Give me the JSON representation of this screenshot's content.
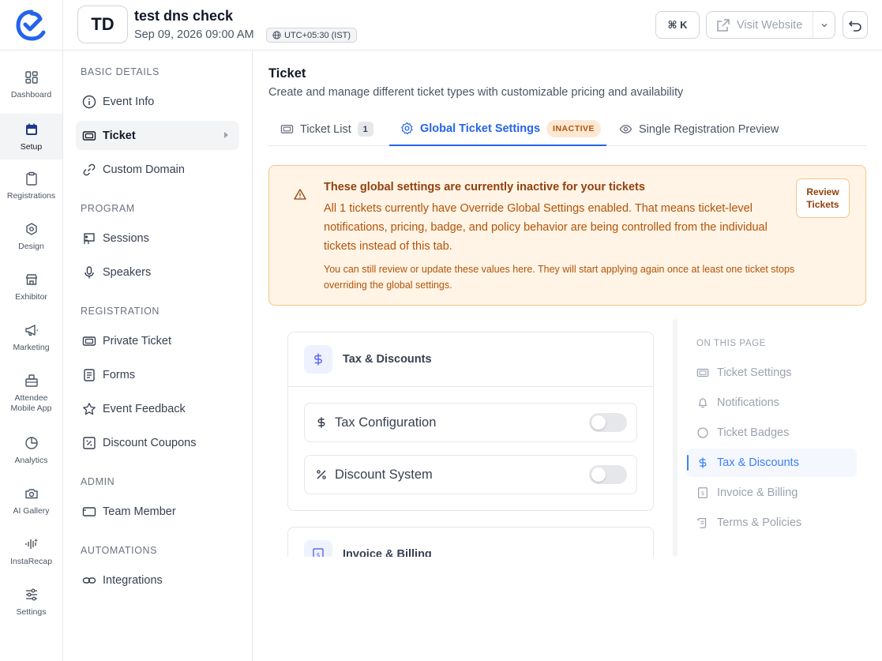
{
  "header": {
    "event_initials": "TD",
    "event_title": "test dns check",
    "event_date": "Sep 09, 2026 09:00 AM",
    "timezone": "UTC+05:30 (IST)",
    "shortcut_label": "⌘ K",
    "visit_label": "Visit Website"
  },
  "rail": {
    "items": [
      {
        "label": "Dashboard",
        "icon": "grid-icon"
      },
      {
        "label": "Setup",
        "icon": "calendar-icon"
      },
      {
        "label": "Registrations",
        "icon": "clipboard-icon"
      },
      {
        "label": "Design",
        "icon": "palette-icon"
      },
      {
        "label": "Exhibitor",
        "icon": "store-icon"
      },
      {
        "label": "Marketing",
        "icon": "megaphone-icon"
      },
      {
        "label": "Attendee",
        "label2": "Mobile App",
        "icon": "mobile-app-icon"
      },
      {
        "label": "Analytics",
        "icon": "pie-chart-icon"
      },
      {
        "label": "AI Gallery",
        "icon": "camera-icon"
      },
      {
        "label": "InstaRecap",
        "icon": "audio-wave-icon"
      },
      {
        "label": "Settings",
        "icon": "sliders-icon"
      }
    ],
    "active": "Setup"
  },
  "nav": {
    "sections": {
      "basic": "BASIC DETAILS",
      "program": "PROGRAM",
      "registration": "REGISTRATION",
      "admin": "ADMIN",
      "automations": "AUTOMATIONS"
    },
    "items": {
      "event_info": "Event Info",
      "ticket": "Ticket",
      "custom_domain": "Custom Domain",
      "sessions": "Sessions",
      "speakers": "Speakers",
      "private_ticket": "Private Ticket",
      "forms": "Forms",
      "event_feedback": "Event Feedback",
      "discount_coupons": "Discount Coupons",
      "team_member": "Team Member",
      "integrations": "Integrations"
    }
  },
  "main": {
    "title": "Ticket",
    "subtitle": "Create and manage different ticket types with customizable pricing and availability",
    "tabs": {
      "ticket_list": "Ticket List",
      "ticket_list_count": "1",
      "global_settings": "Global Ticket Settings",
      "global_badge": "INACTIVE",
      "preview": "Single Registration Preview"
    },
    "alert": {
      "title": "These global settings are currently inactive for your tickets",
      "body": "All 1 tickets currently have Override Global Settings enabled. That means ticket-level notifications, pricing, badge, and policy behavior are being controlled from the individual tickets instead of this tab.",
      "note": "You can still review or update these values here. They will start applying again once at least one ticket stops overriding the global settings.",
      "button_line1": "Review",
      "button_line2": "Tickets"
    },
    "cards": {
      "tax_title": "Tax & Discounts",
      "tax_config": "Tax Configuration",
      "tax_config_on": false,
      "discount_system": "Discount System",
      "discount_system_on": false,
      "invoice_title": "Invoice & Billing"
    }
  },
  "toc": {
    "title": "ON THIS PAGE",
    "items": {
      "ticket_settings": "Ticket Settings",
      "notifications": "Notifications",
      "ticket_badges": "Ticket Badges",
      "tax_discounts": "Tax & Discounts",
      "invoice_billing": "Invoice & Billing",
      "terms_policies": "Terms & Policies"
    },
    "active": "Tax & Discounts"
  },
  "colors": {
    "accent": "#2563eb",
    "warning_bg": "#fff4e5",
    "warning_border": "#f5c58a",
    "warning_text": "#b45309"
  }
}
